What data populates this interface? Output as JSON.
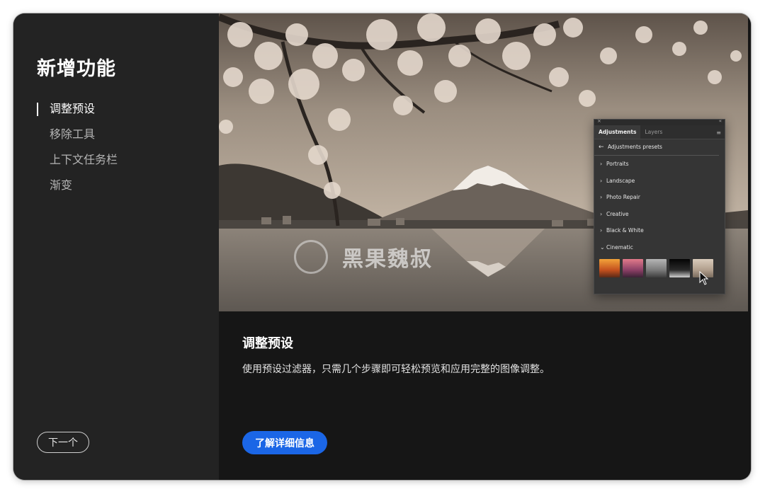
{
  "sidebar": {
    "title": "新增功能",
    "items": [
      {
        "label": "调整预设",
        "active": true
      },
      {
        "label": "移除工具",
        "active": false
      },
      {
        "label": "上下文任务栏",
        "active": false
      },
      {
        "label": "渐变",
        "active": false
      }
    ],
    "next_label": "下一个"
  },
  "hero": {
    "watermark_text": "黑果魏叔",
    "panel": {
      "tabs": [
        "Adjustments",
        "Layers"
      ],
      "back_label": "Adjustments presets",
      "items": [
        "Portraits",
        "Landscape",
        "Photo Repair",
        "Creative",
        "Black & White",
        "Cinematic"
      ],
      "thumb_colors": [
        "#d9712b",
        "#b4535f",
        "#8c8c8c",
        "#1a1a1a",
        "#b9aa9b"
      ]
    }
  },
  "content": {
    "title": "调整预设",
    "description": "使用预设过滤器，只需几个步骤即可轻松预览和应用完整的图像调整。",
    "learn_more_label": "了解详细信息"
  },
  "colors": {
    "accent": "#1b66e6",
    "sidebar_bg": "#232323",
    "content_bg": "#161616"
  }
}
